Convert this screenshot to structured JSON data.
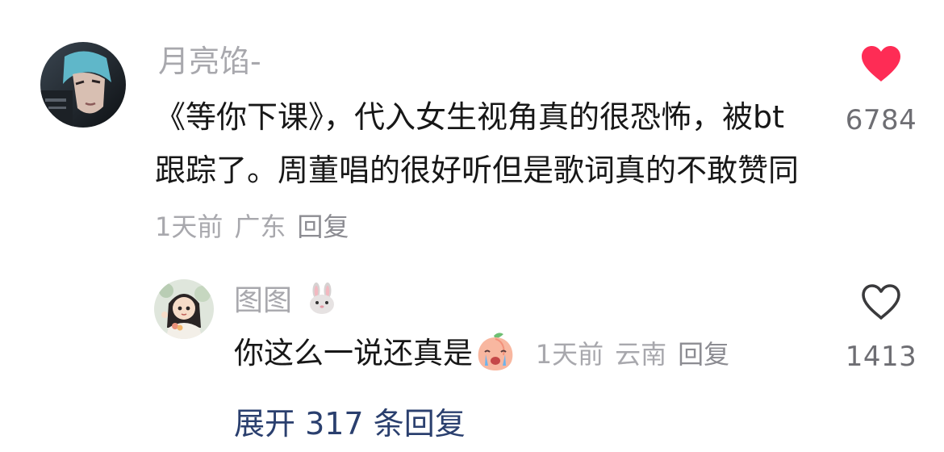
{
  "main_comment": {
    "username": "月亮馅-",
    "text": "《等你下课》，代入女生视角真的很恐怖，被bt跟踪了。周董唱的很好听但是歌词真的不敢赞同",
    "time": "1天前",
    "location": "广东",
    "reply_label": "回复",
    "like_count": "6784",
    "liked": true
  },
  "reply_comment": {
    "username": "图图",
    "text": "你这么一说还真是",
    "time": "1天前",
    "location": "云南",
    "reply_label": "回复",
    "like_count": "1413",
    "liked": false
  },
  "expand_label": "展开 317 条回复",
  "colors": {
    "like_red": "#fe2c55",
    "meta_gray": "#a8a8ad",
    "expand_blue": "#2a3f6e"
  },
  "icons": [
    "heart-filled-icon",
    "heart-outline-icon",
    "bunny-emoji-icon",
    "crying-peach-emoji-icon"
  ]
}
